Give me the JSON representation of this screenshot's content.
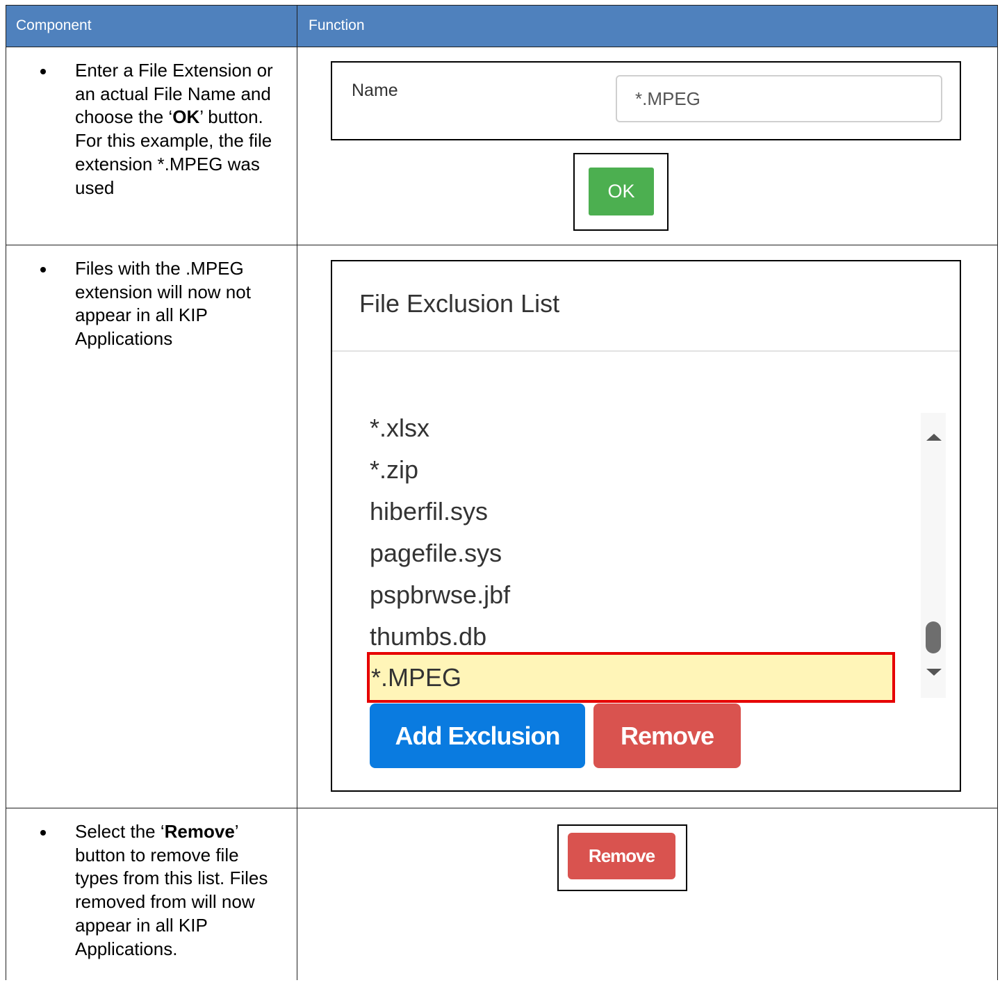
{
  "table": {
    "header": {
      "component": "Component",
      "function": "Function"
    },
    "rows": [
      {
        "text_a": "Enter a File Extension or an actual File Name and choose the ‘",
        "text_bold": "OK",
        "text_b": "’ button. For this example, the file extension *.MPEG was used"
      },
      {
        "text": "Files with the .MPEG extension will now not appear in all KIP Applications"
      },
      {
        "text_a": "Select the ‘",
        "text_bold": "Remove",
        "text_b": "’ button to remove file types from this list. Files removed from will now appear in all KIP Applications."
      }
    ]
  },
  "name_dialog": {
    "label": "Name",
    "value": "*.MPEG",
    "ok_label": "OK"
  },
  "exclusion_dialog": {
    "title": "File Exclusion List",
    "items": [
      "*.xlsx",
      "*.zip",
      "hiberfil.sys",
      "pagefile.sys",
      "pspbrwse.jbf",
      "thumbs.db"
    ],
    "selected_item": "*.MPEG",
    "add_label": "Add Exclusion",
    "remove_label": "Remove"
  },
  "remove_example": {
    "label": "Remove"
  },
  "colors": {
    "header_bg": "#4f81bd",
    "ok_green": "#4caf50",
    "add_blue": "#0a7be0",
    "remove_red": "#d9534f",
    "highlight_yellow": "#fff5b8",
    "highlight_border": "#e60000"
  }
}
